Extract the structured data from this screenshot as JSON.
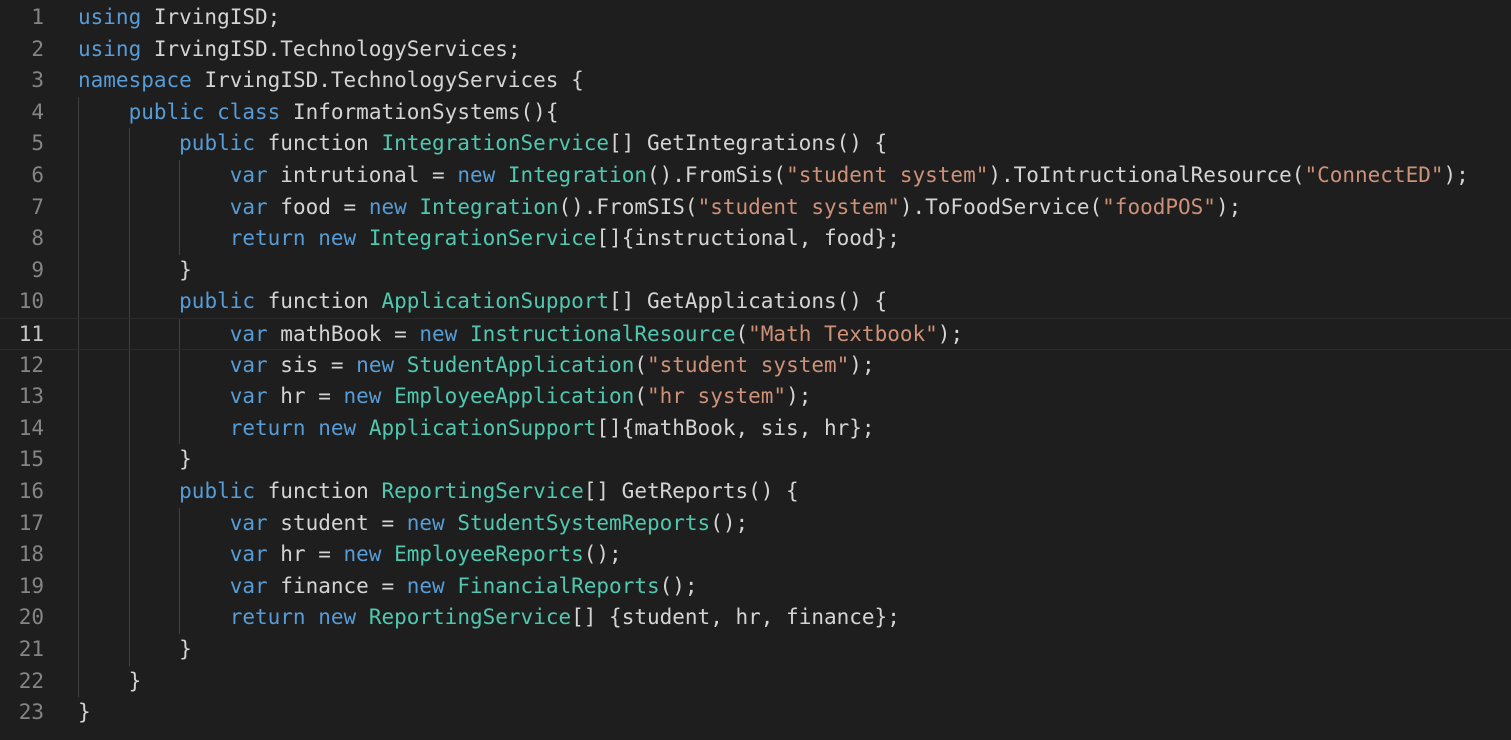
{
  "editor": {
    "current_line": 11,
    "lines": [
      {
        "number": "1",
        "indent": "",
        "tokens": [
          {
            "t": "kw",
            "v": "using"
          },
          {
            "t": "pl",
            "v": " IrvingISD;"
          }
        ]
      },
      {
        "number": "2",
        "indent": "",
        "tokens": [
          {
            "t": "kw",
            "v": "using"
          },
          {
            "t": "pl",
            "v": " IrvingISD.TechnologyServices;"
          }
        ]
      },
      {
        "number": "3",
        "indent": "",
        "tokens": [
          {
            "t": "kw",
            "v": "namespace"
          },
          {
            "t": "pl",
            "v": " IrvingISD.TechnologyServices {"
          }
        ]
      },
      {
        "number": "4",
        "indent": "    ",
        "tokens": [
          {
            "t": "kw",
            "v": "public"
          },
          {
            "t": "pl",
            "v": " "
          },
          {
            "t": "kw",
            "v": "class"
          },
          {
            "t": "pl",
            "v": " InformationSystems(){"
          }
        ]
      },
      {
        "number": "5",
        "indent": "        ",
        "tokens": [
          {
            "t": "kw",
            "v": "public"
          },
          {
            "t": "pl",
            "v": " function "
          },
          {
            "t": "ty",
            "v": "IntegrationService"
          },
          {
            "t": "pl",
            "v": "[] GetIntegrations() {"
          }
        ]
      },
      {
        "number": "6",
        "indent": "            ",
        "tokens": [
          {
            "t": "kw",
            "v": "var"
          },
          {
            "t": "pl",
            "v": " intrutional = "
          },
          {
            "t": "kw",
            "v": "new"
          },
          {
            "t": "pl",
            "v": " "
          },
          {
            "t": "ty",
            "v": "Integration"
          },
          {
            "t": "pl",
            "v": "().FromSis("
          },
          {
            "t": "st",
            "v": "\"student system\""
          },
          {
            "t": "pl",
            "v": ").ToIntructionalResource("
          },
          {
            "t": "st",
            "v": "\"ConnectED\""
          },
          {
            "t": "pl",
            "v": ");"
          }
        ]
      },
      {
        "number": "7",
        "indent": "            ",
        "tokens": [
          {
            "t": "kw",
            "v": "var"
          },
          {
            "t": "pl",
            "v": " food = "
          },
          {
            "t": "kw",
            "v": "new"
          },
          {
            "t": "pl",
            "v": " "
          },
          {
            "t": "ty",
            "v": "Integration"
          },
          {
            "t": "pl",
            "v": "().FromSIS("
          },
          {
            "t": "st",
            "v": "\"student system\""
          },
          {
            "t": "pl",
            "v": ").ToFoodService("
          },
          {
            "t": "st",
            "v": "\"foodPOS\""
          },
          {
            "t": "pl",
            "v": ");"
          }
        ]
      },
      {
        "number": "8",
        "indent": "            ",
        "tokens": [
          {
            "t": "kw",
            "v": "return"
          },
          {
            "t": "pl",
            "v": " "
          },
          {
            "t": "kw",
            "v": "new"
          },
          {
            "t": "pl",
            "v": " "
          },
          {
            "t": "ty",
            "v": "IntegrationService"
          },
          {
            "t": "pl",
            "v": "[]{instructional, food};"
          }
        ]
      },
      {
        "number": "9",
        "indent": "        ",
        "tokens": [
          {
            "t": "pl",
            "v": "}"
          }
        ]
      },
      {
        "number": "10",
        "indent": "        ",
        "tokens": [
          {
            "t": "kw",
            "v": "public"
          },
          {
            "t": "pl",
            "v": " function "
          },
          {
            "t": "ty",
            "v": "ApplicationSupport"
          },
          {
            "t": "pl",
            "v": "[] GetApplications() {"
          }
        ]
      },
      {
        "number": "11",
        "indent": "            ",
        "tokens": [
          {
            "t": "kw",
            "v": "var"
          },
          {
            "t": "pl",
            "v": " mathBook = "
          },
          {
            "t": "kw",
            "v": "new"
          },
          {
            "t": "pl",
            "v": " "
          },
          {
            "t": "ty",
            "v": "InstructionalResource"
          },
          {
            "t": "pl",
            "v": "("
          },
          {
            "t": "st",
            "v": "\"Math Textbook\""
          },
          {
            "t": "pl",
            "v": ");"
          }
        ]
      },
      {
        "number": "12",
        "indent": "            ",
        "tokens": [
          {
            "t": "kw",
            "v": "var"
          },
          {
            "t": "pl",
            "v": " sis = "
          },
          {
            "t": "kw",
            "v": "new"
          },
          {
            "t": "pl",
            "v": " "
          },
          {
            "t": "ty",
            "v": "StudentApplication"
          },
          {
            "t": "pl",
            "v": "("
          },
          {
            "t": "st",
            "v": "\"student system\""
          },
          {
            "t": "pl",
            "v": ");"
          }
        ]
      },
      {
        "number": "13",
        "indent": "            ",
        "tokens": [
          {
            "t": "kw",
            "v": "var"
          },
          {
            "t": "pl",
            "v": " hr = "
          },
          {
            "t": "kw",
            "v": "new"
          },
          {
            "t": "pl",
            "v": " "
          },
          {
            "t": "ty",
            "v": "EmployeeApplication"
          },
          {
            "t": "pl",
            "v": "("
          },
          {
            "t": "st",
            "v": "\"hr system\""
          },
          {
            "t": "pl",
            "v": ");"
          }
        ]
      },
      {
        "number": "14",
        "indent": "            ",
        "tokens": [
          {
            "t": "kw",
            "v": "return"
          },
          {
            "t": "pl",
            "v": " "
          },
          {
            "t": "kw",
            "v": "new"
          },
          {
            "t": "pl",
            "v": " "
          },
          {
            "t": "ty",
            "v": "ApplicationSupport"
          },
          {
            "t": "pl",
            "v": "[]{mathBook, sis, hr};"
          }
        ]
      },
      {
        "number": "15",
        "indent": "        ",
        "tokens": [
          {
            "t": "pl",
            "v": "}"
          }
        ]
      },
      {
        "number": "16",
        "indent": "        ",
        "tokens": [
          {
            "t": "kw",
            "v": "public"
          },
          {
            "t": "pl",
            "v": " function "
          },
          {
            "t": "ty",
            "v": "ReportingService"
          },
          {
            "t": "pl",
            "v": "[] GetReports() {"
          }
        ]
      },
      {
        "number": "17",
        "indent": "            ",
        "tokens": [
          {
            "t": "kw",
            "v": "var"
          },
          {
            "t": "pl",
            "v": " student = "
          },
          {
            "t": "kw",
            "v": "new"
          },
          {
            "t": "pl",
            "v": " "
          },
          {
            "t": "ty",
            "v": "StudentSystemReports"
          },
          {
            "t": "pl",
            "v": "();"
          }
        ]
      },
      {
        "number": "18",
        "indent": "            ",
        "tokens": [
          {
            "t": "kw",
            "v": "var"
          },
          {
            "t": "pl",
            "v": " hr = "
          },
          {
            "t": "kw",
            "v": "new"
          },
          {
            "t": "pl",
            "v": " "
          },
          {
            "t": "ty",
            "v": "EmployeeReports"
          },
          {
            "t": "pl",
            "v": "();"
          }
        ]
      },
      {
        "number": "19",
        "indent": "            ",
        "tokens": [
          {
            "t": "kw",
            "v": "var"
          },
          {
            "t": "pl",
            "v": " finance = "
          },
          {
            "t": "kw",
            "v": "new"
          },
          {
            "t": "pl",
            "v": " "
          },
          {
            "t": "ty",
            "v": "FinancialReports"
          },
          {
            "t": "pl",
            "v": "();"
          }
        ]
      },
      {
        "number": "20",
        "indent": "            ",
        "tokens": [
          {
            "t": "kw",
            "v": "return"
          },
          {
            "t": "pl",
            "v": " "
          },
          {
            "t": "kw",
            "v": "new"
          },
          {
            "t": "pl",
            "v": " "
          },
          {
            "t": "ty",
            "v": "ReportingService"
          },
          {
            "t": "pl",
            "v": "[] {student, hr, finance};"
          }
        ]
      },
      {
        "number": "21",
        "indent": "        ",
        "tokens": [
          {
            "t": "pl",
            "v": "}"
          }
        ]
      },
      {
        "number": "22",
        "indent": "    ",
        "tokens": [
          {
            "t": "pl",
            "v": "}"
          }
        ]
      },
      {
        "number": "23",
        "indent": "",
        "tokens": [
          {
            "t": "pl",
            "v": "}"
          }
        ]
      }
    ]
  },
  "colors": {
    "background": "#1e1e1e",
    "keyword": "#569cd6",
    "type": "#4ec9b0",
    "string": "#ce9178",
    "plain": "#d4d4d4",
    "line_number": "#858585",
    "line_number_active": "#c6c6c6"
  }
}
